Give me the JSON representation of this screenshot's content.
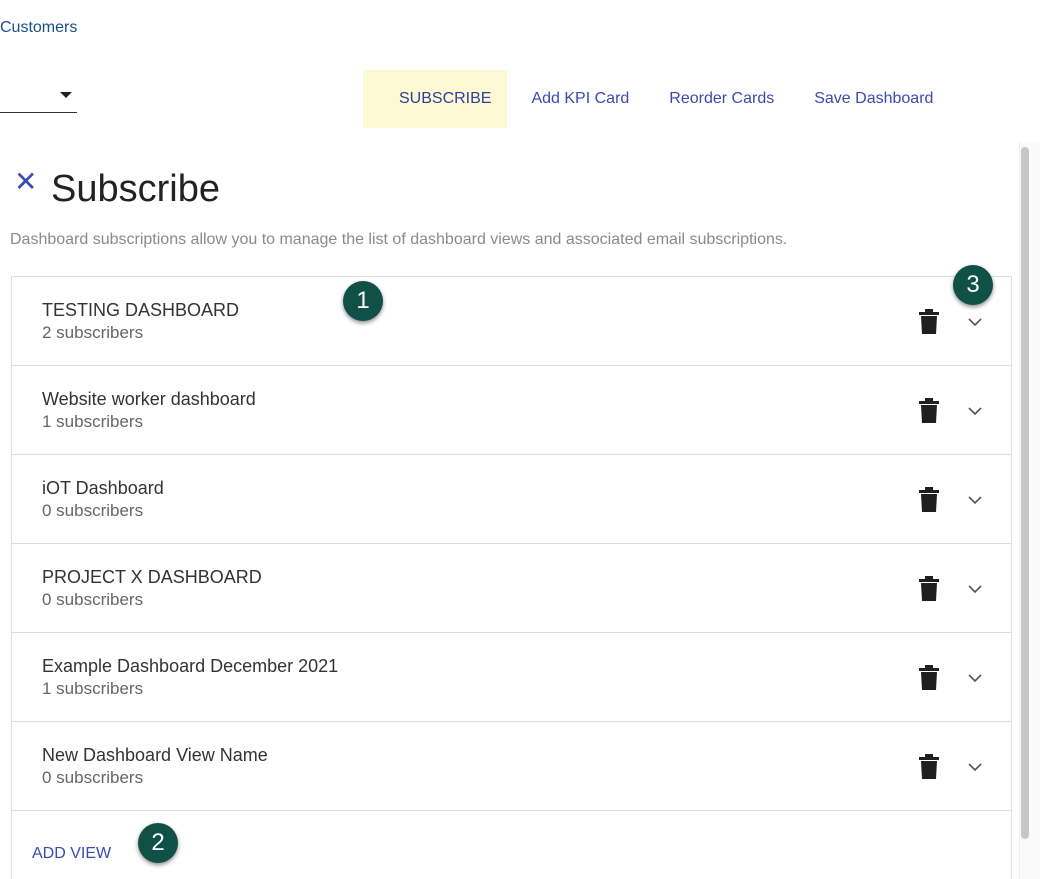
{
  "breadcrumb": "Customers",
  "toolbar": {
    "subscribe": "SUBSCRIBE",
    "add_kpi": "Add KPI Card",
    "reorder": "Reorder Cards",
    "save": "Save Dashboard"
  },
  "panel": {
    "close_icon": "close-icon",
    "title": "Subscribe",
    "description": "Dashboard subscriptions allow you to manage the list of dashboard views and associated email subscriptions."
  },
  "views": [
    {
      "name": "TESTING DASHBOARD",
      "subscribers": "2 subscribers"
    },
    {
      "name": "Website worker dashboard",
      "subscribers": "1 subscribers"
    },
    {
      "name": "iOT Dashboard",
      "subscribers": "0 subscribers"
    },
    {
      "name": "PROJECT X DASHBOARD",
      "subscribers": "0 subscribers"
    },
    {
      "name": "Example Dashboard December 2021",
      "subscribers": "1 subscribers"
    },
    {
      "name": "New Dashboard View Name",
      "subscribers": "0 subscribers"
    }
  ],
  "add_view": "ADD VIEW",
  "callouts": [
    "1",
    "2",
    "3"
  ],
  "colors": {
    "accent": "#3a4ab0",
    "active_tab_bg": "#fdf9d2",
    "callout_bg": "#0f5146"
  }
}
